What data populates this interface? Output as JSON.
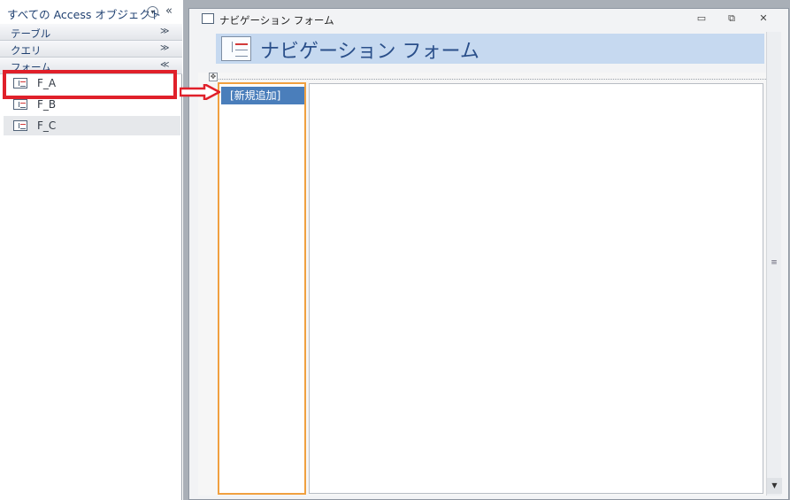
{
  "nav_pane": {
    "title": "すべての Access オブジェクト",
    "dropdown_glyph": "▾",
    "collapse_glyph": "«",
    "groups": [
      {
        "label": "テーブル",
        "chevron": "≫"
      },
      {
        "label": "クエリ",
        "chevron": "≫"
      },
      {
        "label": "フォーム",
        "chevron": "≪"
      }
    ],
    "items": [
      {
        "label": "F_A"
      },
      {
        "label": "F_B"
      },
      {
        "label": "F_C"
      }
    ]
  },
  "window": {
    "title": "ナビゲーション フォーム",
    "minimize": "▭",
    "restore": "⧉",
    "close": "✕"
  },
  "form": {
    "header_title": "ナビゲーション フォーム",
    "move_handle": "✥",
    "new_tab_label": "[新規追加]"
  },
  "scrollbar": {
    "grip": "≡",
    "down": "▼"
  },
  "colors": {
    "highlight": "#e0202a",
    "header_bg": "#c6d9f0",
    "tab_selected": "#4a7ebb",
    "column_border": "#f0a040"
  }
}
